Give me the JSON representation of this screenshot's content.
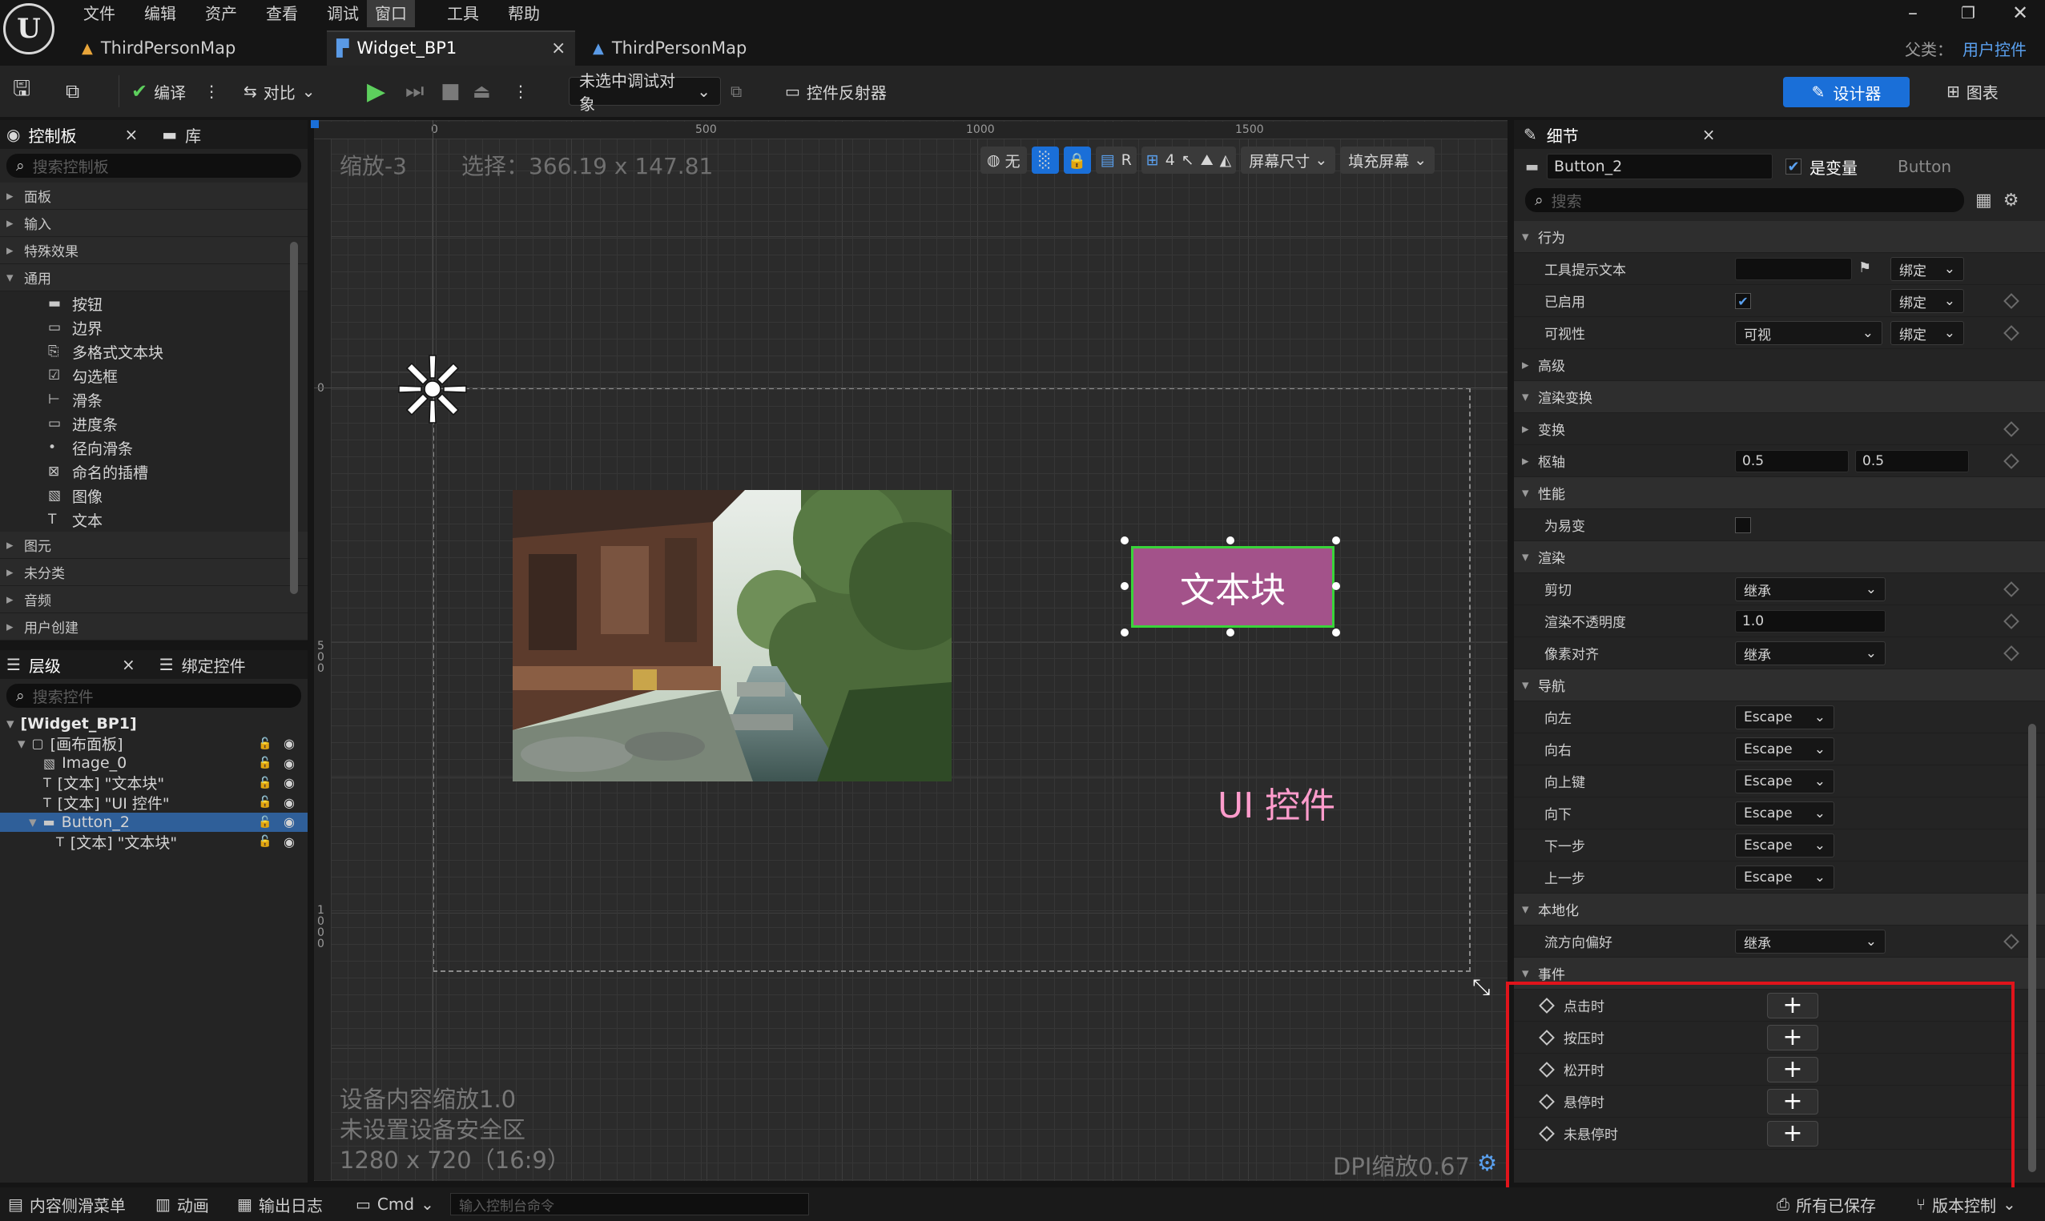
{
  "menu": [
    "文件",
    "编辑",
    "资产",
    "查看",
    "调试",
    "窗口",
    "工具",
    "帮助"
  ],
  "menu_active_index": 5,
  "tabs": [
    {
      "label": "ThirdPersonMap"
    },
    {
      "label": "Widget_BP1",
      "close": "×"
    },
    {
      "label": "ThirdPersonMap"
    }
  ],
  "parent_class": {
    "label": "父类：",
    "value": "用户控件"
  },
  "toolbar": {
    "compile": "编译",
    "diff": "对比",
    "debug_target": "未选中调试对象",
    "widget_reflector": "控件反射器",
    "designer": "设计器",
    "graph": "图表"
  },
  "palette": {
    "tab_control": "控制板",
    "tab_library": "库",
    "close": "×",
    "search_placeholder": "搜索控制板",
    "categories_top": [
      "面板",
      "输入",
      "特殊效果"
    ],
    "common_label": "通用",
    "common_items": [
      "按钮",
      "边界",
      "多格式文本块",
      "勾选框",
      "滑条",
      "进度条",
      "径向滑条",
      "命名的插槽",
      "图像",
      "文本"
    ],
    "categories_bottom": [
      "图元",
      "未分类",
      "音频",
      "用户创建"
    ]
  },
  "hierarchy": {
    "tab_hierarchy": "层级",
    "tab_bind": "绑定控件",
    "close": "×",
    "search_placeholder": "搜索控件",
    "rows": [
      {
        "label": "[Widget_BP1]"
      },
      {
        "label": "[画布面板]"
      },
      {
        "label": "Image_0"
      },
      {
        "label": "[文本] \"文本块\""
      },
      {
        "label": "[文本] \"UI 控件\""
      },
      {
        "label": "Button_2"
      },
      {
        "label": "[文本] \"文本块\""
      }
    ]
  },
  "canvas": {
    "zoom": "缩放-3",
    "selection": "选择：366.19 x 147.81",
    "ruler_h": [
      "0",
      "500",
      "1000",
      "1500"
    ],
    "ruler_v": [
      "0",
      "500",
      "1000"
    ],
    "globe_label": "无",
    "r_label": "R",
    "grid_num": "4",
    "screen_size": "屏幕尺寸",
    "fill_screen": "填充屏幕",
    "button_text": "文本块",
    "ui_text": "UI 控件",
    "info": [
      "设备内容缩放1.0",
      "未设置设备安全区",
      "1280 x 720（16:9）"
    ],
    "dpi": "DPI缩放0.67"
  },
  "details": {
    "tab": "细节",
    "close": "×",
    "name": "Button_2",
    "is_variable": "是变量",
    "class": "Button",
    "search_placeholder": "搜索",
    "bind": "绑定",
    "rows": [
      {
        "kind": "sec",
        "label": "行为",
        "open": true
      },
      {
        "kind": "prop",
        "label": "工具提示文本",
        "type": "text",
        "bind": true,
        "flag": true
      },
      {
        "kind": "prop",
        "label": "已启用",
        "type": "check",
        "bind": true,
        "diamond": true
      },
      {
        "kind": "prop",
        "label": "可视性",
        "type": "combo",
        "value": "可视",
        "bind": true,
        "diamond": true
      },
      {
        "kind": "sub",
        "label": "高级"
      },
      {
        "kind": "sec",
        "label": "渲染变换",
        "open": true
      },
      {
        "kind": "sub",
        "label": "变换",
        "diamond": true
      },
      {
        "kind": "sub",
        "label": "枢轴",
        "type": "pair",
        "v1": "0.5",
        "v2": "0.5",
        "diamond": true
      },
      {
        "kind": "sec",
        "label": "性能",
        "open": true
      },
      {
        "kind": "prop",
        "label": "为易变",
        "type": "emptycheck"
      },
      {
        "kind": "sec",
        "label": "渲染",
        "open": true
      },
      {
        "kind": "prop",
        "label": "剪切",
        "type": "combo",
        "value": "继承",
        "diamond": true
      },
      {
        "kind": "prop",
        "label": "渲染不透明度",
        "type": "text",
        "value": "1.0",
        "diamond": true
      },
      {
        "kind": "prop",
        "label": "像素对齐",
        "type": "combo",
        "value": "继承",
        "diamond": true
      },
      {
        "kind": "sec",
        "label": "导航",
        "open": true
      },
      {
        "kind": "prop",
        "label": "向左",
        "type": "small",
        "value": "Escape"
      },
      {
        "kind": "prop",
        "label": "向右",
        "type": "small",
        "value": "Escape"
      },
      {
        "kind": "prop",
        "label": "向上键",
        "type": "small",
        "value": "Escape"
      },
      {
        "kind": "prop",
        "label": "向下",
        "type": "small",
        "value": "Escape"
      },
      {
        "kind": "prop",
        "label": "下一步",
        "type": "small",
        "value": "Escape"
      },
      {
        "kind": "prop",
        "label": "上一步",
        "type": "small",
        "value": "Escape"
      },
      {
        "kind": "sec",
        "label": "本地化",
        "open": true
      },
      {
        "kind": "prop",
        "label": "流方向偏好",
        "type": "combo",
        "value": "继承",
        "diamond": true
      },
      {
        "kind": "sec",
        "label": "事件",
        "open": true
      },
      {
        "kind": "event",
        "label": "点击时"
      },
      {
        "kind": "event",
        "label": "按压时"
      },
      {
        "kind": "event",
        "label": "松开时"
      },
      {
        "kind": "event",
        "label": "悬停时"
      },
      {
        "kind": "event",
        "label": "未悬停时"
      }
    ]
  },
  "statusbar": {
    "content_drawer": "内容侧滑菜单",
    "anim": "动画",
    "output_log": "输出日志",
    "cmd": "Cmd",
    "cmd_placeholder": "输入控制台命令",
    "all_saved": "所有已保存",
    "version_control": "版本控制"
  },
  "colors": {
    "accent": "#1a6fd8",
    "button_fill": "#a3528a",
    "button_border": "#39d43a",
    "ui_text": "#ff9ccc",
    "highlight": "#e0141b"
  }
}
